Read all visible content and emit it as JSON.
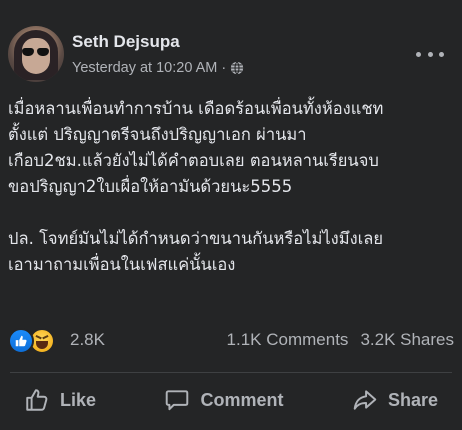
{
  "post": {
    "author_name": "Seth Dejsupa",
    "timestamp": "Yesterday at 10:20 AM",
    "separator": "·",
    "privacy_icon": "globe-icon",
    "more_icon": "more-horizontal-icon",
    "text_lines": [
      "เมื่อหลานเพื่อนทำการบ้าน เดือดร้อนเพื่อนทั้งห้องแชท",
      "ตั้งแต่ ปริญญาตรีจนถึงปริญญาเอก ผ่านมา",
      "เกือบ2ชม.แล้วยังไม่ได้คำตอบเลย ตอนหลานเรียนจบ",
      "ขอปริญญา2ใบเผื่อให้อามันด้วยนะ5555",
      "",
      "ปล. โจทย์มันไม่ได้กำหนดว่าขนานกันหรือไม่ไงมึงเลย",
      "เอามาถามเพื่อนในเฟสแค่นั้นเอง"
    ]
  },
  "stats": {
    "reaction_icons": [
      "like-reaction-icon",
      "haha-reaction-icon"
    ],
    "reaction_count": "2.8K",
    "comments": "1.1K Comments",
    "shares": "3.2K Shares"
  },
  "actions": {
    "like_label": "Like",
    "comment_label": "Comment",
    "share_label": "Share"
  },
  "colors": {
    "background": "#242526",
    "primary_text": "#e4e6eb",
    "secondary_text": "#b0b3b8",
    "like_blue": "#1b8bfb",
    "haha_yellow": "#f5b523"
  }
}
